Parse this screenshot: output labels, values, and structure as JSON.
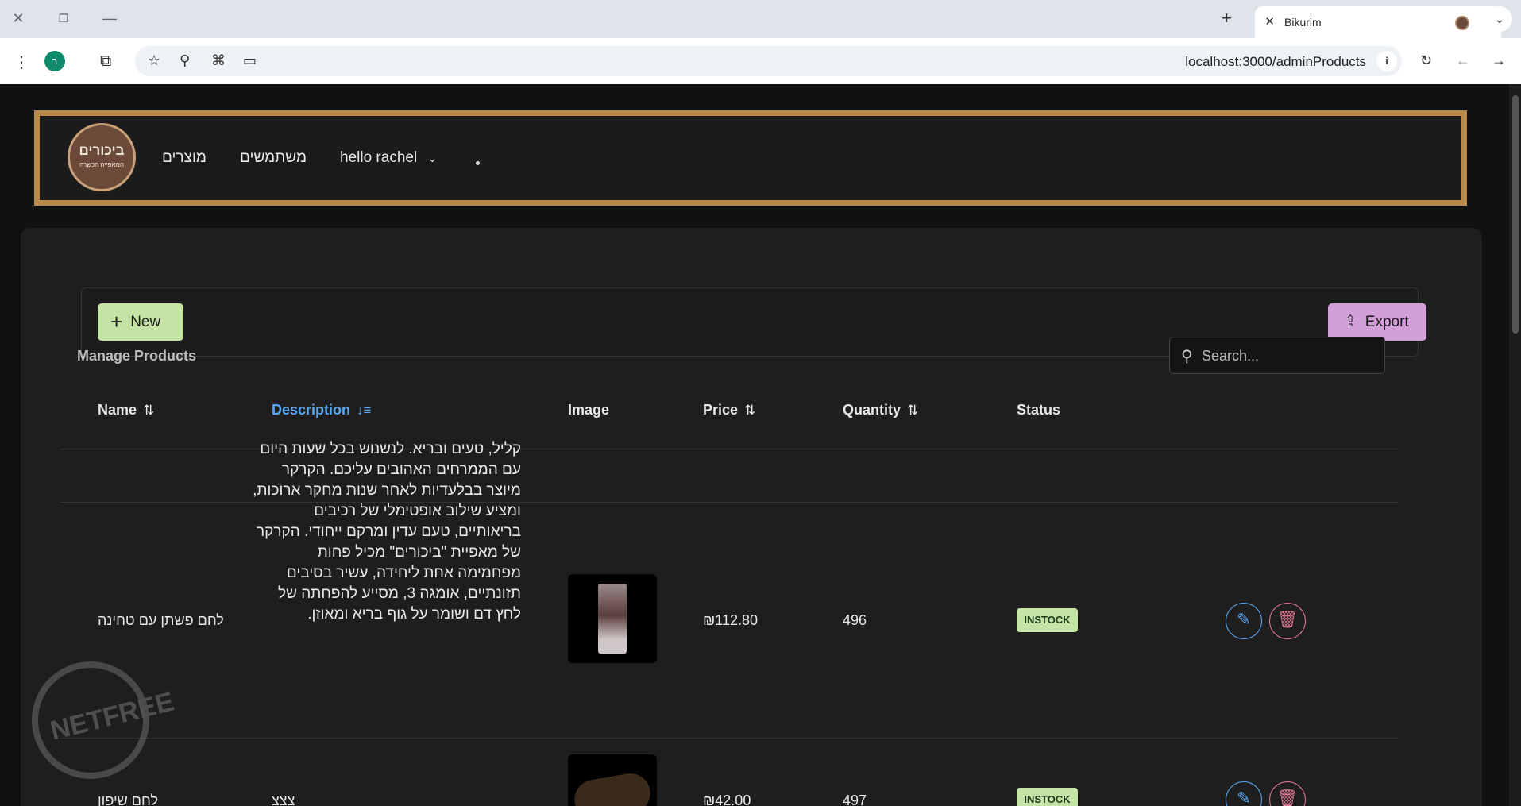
{
  "browser": {
    "tab_title": "Bikurim",
    "url": "localhost:3000/adminProducts",
    "profile_initial": "ר"
  },
  "nav": {
    "logo_text": "ביכורים",
    "logo_sub": "המאפייה הכשרה",
    "items": [
      {
        "label": "מוצרים"
      },
      {
        "label": "משתמשים"
      },
      {
        "label": "hello rachel"
      }
    ]
  },
  "toolbar": {
    "new_label": "New",
    "export_label": "Export"
  },
  "table": {
    "title": "Manage Products",
    "search_placeholder": "Search...",
    "columns": {
      "name": "Name",
      "description": "Description",
      "image": "Image",
      "price": "Price",
      "quantity": "Quantity",
      "status": "Status"
    },
    "rows": [
      {
        "name": "לחם פשתן עם טחינה",
        "description": "קליל, טעים ובריא. לנשנוש בכל שעות היום עם הממרחים האהובים עליכם. הקרקר מיוצר בבלעדיות לאחר שנות מחקר ארוכות, ומציע שילוב אופטימלי של רכיבים בריאותיים, טעם עדין ומרקם ייחודי. הקרקר של מאפיית \"ביכורים\" מכיל פחות מפחמימה אחת ליחידה, עשיר בסיבים תזונתיים, אומגה 3, מסייע להפחתה של לחץ דם ושומר על גוף בריא ומאוזן.",
        "price": "₪112.80",
        "quantity": "496",
        "status": "INSTOCK"
      },
      {
        "name": "לחם שיפון",
        "description": "צצצ",
        "price": "₪42.00",
        "quantity": "497",
        "status": "INSTOCK"
      }
    ]
  },
  "watermark": {
    "text": "NETFREE"
  },
  "colors": {
    "nav_border": "#b8894a",
    "new_button": "#c5e3a4",
    "export_button": "#d39fd9",
    "active_sort": "#5aa7f2",
    "delete": "#e27a94"
  }
}
